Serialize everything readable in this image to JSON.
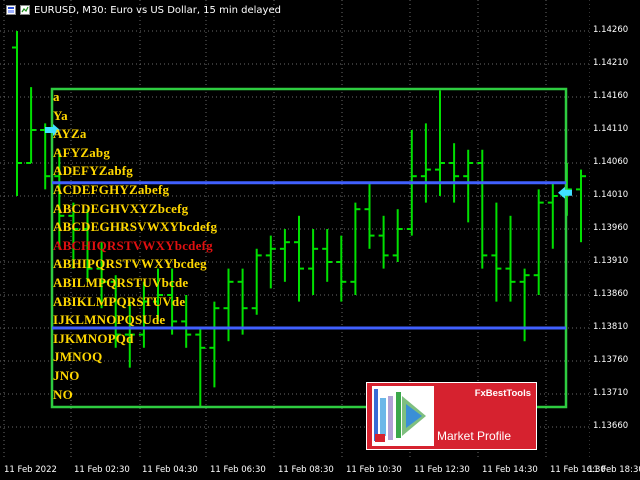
{
  "header": {
    "title": "EURUSD, M30:  Euro vs US Dollar, 15 min delayed"
  },
  "icons": {
    "window": "chart-window-icon",
    "mode": "delayed-quotes-icon"
  },
  "price_axis": {
    "labels": [
      "1.14260",
      "1.14210",
      "1.14160",
      "1.14110",
      "1.14060",
      "1.14010",
      "1.13960",
      "1.13910",
      "1.13860",
      "1.13810",
      "1.13760",
      "1.13710",
      "1.13660"
    ]
  },
  "time_axis": {
    "labels": [
      "11 Feb 2022",
      "11 Feb 02:30",
      "11 Feb 04:30",
      "11 Feb 06:30",
      "11 Feb 08:30",
      "11 Feb 10:30",
      "11 Feb 12:30",
      "11 Feb 14:30",
      "11 Feb 16:30",
      "11 Feb 18:30"
    ]
  },
  "profile": {
    "rows": [
      "a",
      "Ya",
      "AYZa",
      "AFYZabg",
      "ADEFYZabfg",
      "ACDEFGHYZabefg",
      "ABCDEGHVXYZbcefg",
      "ABCDEGHRSVWXYbcdefg",
      "ABCHIQRSTVWXYbcdefg",
      "ABHIPQRSTVWXYbcdeg",
      "ABILMPQRSTUVbcde",
      "ABIKLMPQRSTUVde",
      "IJKLMNOPQSUde",
      "IJKMNOPQd",
      "JMNOQ",
      "JNO",
      "NO"
    ],
    "poc_index": 8,
    "colors": {
      "letters": "#ffd700",
      "poc": "#e01010",
      "box": "#2ecc40",
      "value_area": "#4060ff",
      "candles": "#00e000"
    }
  },
  "promo": {
    "brand": "FxBestTools",
    "title": "Market Profile",
    "background": "#d6222f"
  },
  "chart_data": {
    "type": "candlestick",
    "symbol": "EURUSD",
    "timeframe": "M30",
    "ylim": [
      1.1362,
      1.143
    ],
    "value_area": {
      "high": 1.1403,
      "low": 1.1381
    },
    "current_price": 1.14015,
    "candles": [
      {
        "o": 1.14235,
        "h": 1.1426,
        "l": 1.1401,
        "c": 1.1406
      },
      {
        "o": 1.1406,
        "h": 1.14175,
        "l": 1.1406,
        "c": 1.1411
      },
      {
        "o": 1.1411,
        "h": 1.1412,
        "l": 1.1402,
        "c": 1.1404
      },
      {
        "o": 1.1404,
        "h": 1.1408,
        "l": 1.1393,
        "c": 1.1398
      },
      {
        "o": 1.1398,
        "h": 1.14,
        "l": 1.139,
        "c": 1.1396
      },
      {
        "o": 1.1396,
        "h": 1.1399,
        "l": 1.1388,
        "c": 1.139
      },
      {
        "o": 1.139,
        "h": 1.1394,
        "l": 1.1384,
        "c": 1.1388
      },
      {
        "o": 1.1388,
        "h": 1.1389,
        "l": 1.1378,
        "c": 1.138
      },
      {
        "o": 1.138,
        "h": 1.1385,
        "l": 1.1375,
        "c": 1.138
      },
      {
        "o": 1.138,
        "h": 1.1388,
        "l": 1.1378,
        "c": 1.1385
      },
      {
        "o": 1.1385,
        "h": 1.139,
        "l": 1.1382,
        "c": 1.1386
      },
      {
        "o": 1.1386,
        "h": 1.139,
        "l": 1.138,
        "c": 1.1382
      },
      {
        "o": 1.1382,
        "h": 1.1386,
        "l": 1.1378,
        "c": 1.138
      },
      {
        "o": 1.138,
        "h": 1.1381,
        "l": 1.1369,
        "c": 1.1378
      },
      {
        "o": 1.1378,
        "h": 1.1385,
        "l": 1.1372,
        "c": 1.1384
      },
      {
        "o": 1.1384,
        "h": 1.139,
        "l": 1.1379,
        "c": 1.1388
      },
      {
        "o": 1.1388,
        "h": 1.139,
        "l": 1.138,
        "c": 1.1384
      },
      {
        "o": 1.1384,
        "h": 1.1393,
        "l": 1.1383,
        "c": 1.1392
      },
      {
        "o": 1.1392,
        "h": 1.1395,
        "l": 1.1387,
        "c": 1.1393
      },
      {
        "o": 1.1393,
        "h": 1.1396,
        "l": 1.1388,
        "c": 1.1394
      },
      {
        "o": 1.1394,
        "h": 1.1398,
        "l": 1.1385,
        "c": 1.139
      },
      {
        "o": 1.139,
        "h": 1.1396,
        "l": 1.1386,
        "c": 1.1393
      },
      {
        "o": 1.1393,
        "h": 1.1396,
        "l": 1.1388,
        "c": 1.1391
      },
      {
        "o": 1.1391,
        "h": 1.1395,
        "l": 1.1385,
        "c": 1.1388
      },
      {
        "o": 1.1388,
        "h": 1.14,
        "l": 1.1386,
        "c": 1.1399
      },
      {
        "o": 1.1399,
        "h": 1.1403,
        "l": 1.1393,
        "c": 1.1395
      },
      {
        "o": 1.1395,
        "h": 1.1398,
        "l": 1.139,
        "c": 1.1392
      },
      {
        "o": 1.1392,
        "h": 1.1399,
        "l": 1.1391,
        "c": 1.1396
      },
      {
        "o": 1.1396,
        "h": 1.1411,
        "l": 1.1395,
        "c": 1.1404
      },
      {
        "o": 1.1404,
        "h": 1.1412,
        "l": 1.14,
        "c": 1.1405
      },
      {
        "o": 1.1405,
        "h": 1.1417,
        "l": 1.1401,
        "c": 1.1406
      },
      {
        "o": 1.1406,
        "h": 1.1409,
        "l": 1.14,
        "c": 1.1404
      },
      {
        "o": 1.1404,
        "h": 1.1408,
        "l": 1.1397,
        "c": 1.1406
      },
      {
        "o": 1.1406,
        "h": 1.1408,
        "l": 1.139,
        "c": 1.1392
      },
      {
        "o": 1.1392,
        "h": 1.14,
        "l": 1.1385,
        "c": 1.139
      },
      {
        "o": 1.139,
        "h": 1.1398,
        "l": 1.1385,
        "c": 1.1388
      },
      {
        "o": 1.1388,
        "h": 1.139,
        "l": 1.1379,
        "c": 1.1389
      },
      {
        "o": 1.1389,
        "h": 1.1402,
        "l": 1.1386,
        "c": 1.14
      },
      {
        "o": 1.14,
        "h": 1.1403,
        "l": 1.1393,
        "c": 1.1401
      },
      {
        "o": 1.1401,
        "h": 1.1406,
        "l": 1.1398,
        "c": 1.1402
      },
      {
        "o": 1.1402,
        "h": 1.1405,
        "l": 1.1394,
        "c": 1.1404
      }
    ]
  }
}
